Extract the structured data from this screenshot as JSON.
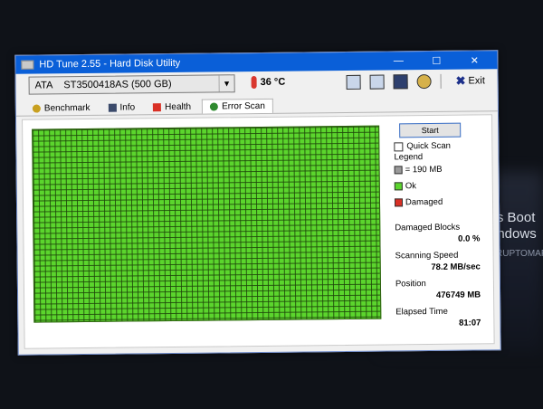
{
  "background": {
    "line1": "'s Boot",
    "line2": "indows",
    "line3": "RUPTOMAP"
  },
  "window": {
    "title": "HD Tune 2.55 - Hard Disk Utility",
    "controls": {
      "minimize": "—",
      "maximize": "☐",
      "close": "✕"
    }
  },
  "toolbar": {
    "drive_type": "ATA",
    "drive_name": "ST3500418AS (500 GB)",
    "temperature": "36 °C",
    "exit_label": "Exit"
  },
  "tabs": [
    {
      "label": "Benchmark",
      "icon": "benchmark-icon"
    },
    {
      "label": "Info",
      "icon": "info-icon"
    },
    {
      "label": "Health",
      "icon": "health-icon"
    },
    {
      "label": "Error Scan",
      "icon": "magnifier-icon",
      "active": true
    }
  ],
  "scan": {
    "start_label": "Start",
    "quick_scan_label": "Quick Scan",
    "quick_scan_checked": false,
    "legend_title": "Legend",
    "legend": [
      {
        "label": "= 190 MB",
        "color": "#9a9a9a"
      },
      {
        "label": "Ok",
        "color": "#5bd52d"
      },
      {
        "label": "Damaged",
        "color": "#d93025"
      }
    ],
    "damaged_blocks_label": "Damaged Blocks",
    "damaged_blocks_value": "0.0 %",
    "speed_label": "Scanning Speed",
    "speed_value": "78.2 MB/sec",
    "position_label": "Position",
    "position_value": "476749 MB",
    "elapsed_label": "Elapsed Time",
    "elapsed_value": "81:07"
  },
  "colors": {
    "title_bar": "#0a5fd8",
    "ok_block": "#5bd52d",
    "damaged_block": "#d93025"
  }
}
